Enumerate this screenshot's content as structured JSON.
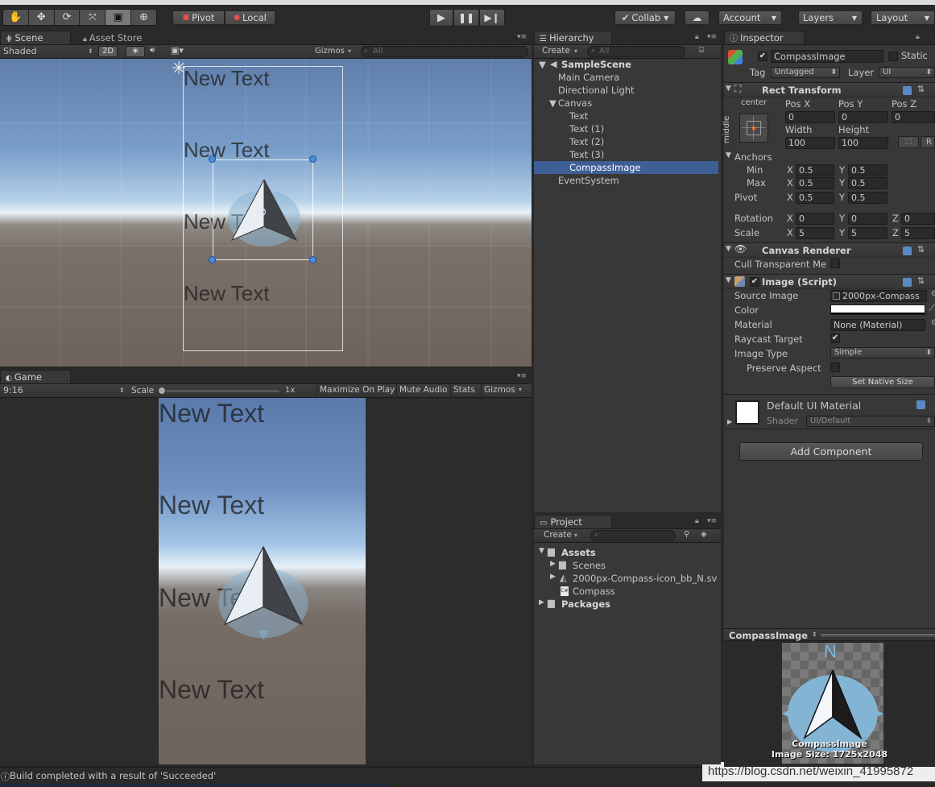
{
  "toolbar": {
    "pivot": "Pivot",
    "local": "Local",
    "collab": "Collab",
    "account": "Account",
    "layers": "Layers",
    "layout": "Layout"
  },
  "scene": {
    "tab_scene": "Scene",
    "tab_asset_store": "Asset Store",
    "shading": "Shaded",
    "mode_2d": "2D",
    "gizmos": "Gizmos",
    "search_placeholder": "All",
    "texts": [
      "New Text",
      "New Text",
      "New Text",
      "New Text"
    ],
    "compass_letter": "N"
  },
  "game": {
    "tab": "Game",
    "aspect": "9:16",
    "scale_label": "Scale",
    "scale_value": "1x",
    "maximize": "Maximize On Play",
    "mute": "Mute Audio",
    "stats": "Stats",
    "gizmos": "Gizmos",
    "texts": [
      "New Text",
      "New Text",
      "New Text",
      "New Text"
    ]
  },
  "hierarchy": {
    "tab": "Hierarchy",
    "create": "Create",
    "search_placeholder": "All",
    "scene_name": "SampleScene",
    "items": [
      "Main Camera",
      "Directional Light",
      "Canvas",
      "Text",
      "Text (1)",
      "Text (2)",
      "Text (3)",
      "CompassImage",
      "EventSystem"
    ]
  },
  "project": {
    "tab": "Project",
    "create": "Create",
    "items": [
      "Assets",
      "Scenes",
      "2000px-Compass-icon_bb_N.sv",
      "Compass",
      "Packages"
    ]
  },
  "inspector": {
    "tab": "Inspector",
    "object_name": "CompassImage",
    "static_label": "Static",
    "tag_label": "Tag",
    "tag_value": "Untagged",
    "layer_label": "Layer",
    "layer_value": "UI",
    "rect_transform": {
      "title": "Rect Transform",
      "anchor_h": "center",
      "anchor_v": "middle",
      "pos_x_label": "Pos X",
      "pos_y_label": "Pos Y",
      "pos_z_label": "Pos Z",
      "pos_x": "0",
      "pos_y": "0",
      "pos_z": "0",
      "width_label": "Width",
      "height_label": "Height",
      "width": "100",
      "height": "100",
      "r_label": "R",
      "anchors_label": "Anchors",
      "min_label": "Min",
      "max_label": "Max",
      "x": "X",
      "y": "Y",
      "z": "Z",
      "min_x": "0.5",
      "min_y": "0.5",
      "max_x": "0.5",
      "max_y": "0.5",
      "pivot_label": "Pivot",
      "pivot_x": "0.5",
      "pivot_y": "0.5",
      "rotation_label": "Rotation",
      "rot_x": "0",
      "rot_y": "0",
      "rot_z": "0",
      "scale_label": "Scale",
      "scale_x": "5",
      "scale_y": "5",
      "scale_z": "5"
    },
    "canvas_renderer": {
      "title": "Canvas Renderer",
      "cull_label": "Cull Transparent Me"
    },
    "image_script": {
      "title": "Image (Script)",
      "source_image_label": "Source Image",
      "source_image_value": "2000px-Compass",
      "color_label": "Color",
      "material_label": "Material",
      "material_value": "None (Material)",
      "raycast_label": "Raycast Target",
      "image_type_label": "Image Type",
      "image_type_value": "Simple",
      "preserve_label": "Preserve Aspect",
      "set_native": "Set Native Size"
    },
    "material": {
      "name": "Default UI Material",
      "shader_label": "Shader",
      "shader_value": "UI/Default"
    },
    "add_component": "Add Component",
    "preview_title": "CompassImage",
    "preview_name": "CompassImage",
    "preview_size": "Image Size: 1725x2048",
    "preview_letter": "N"
  },
  "status": {
    "message": "Build completed with a result of 'Succeeded'",
    "watermark": "https://blog.csdn.net/weixin_41995872"
  }
}
